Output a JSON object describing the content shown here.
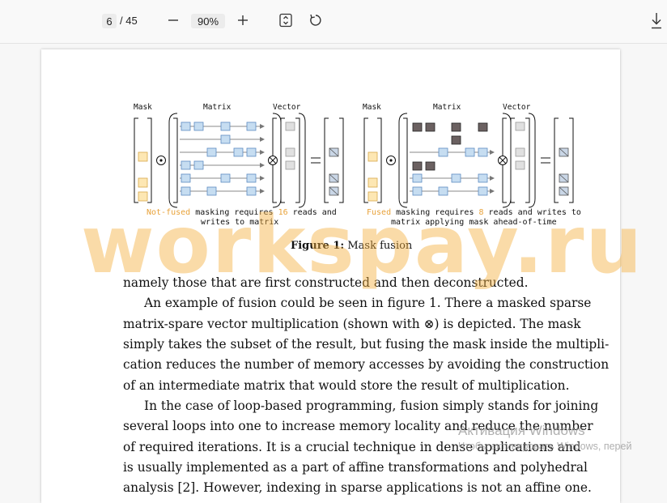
{
  "toolbar": {
    "page_current": "6",
    "page_total": "/ 45",
    "zoom_out": "−",
    "zoom_level": "90%",
    "zoom_in": "+"
  },
  "figure": {
    "left": {
      "mask_label": "Mask",
      "matrix_label": "Matrix",
      "vector_label": "Vector",
      "caption_line1_highlight": "Not-fused",
      "caption_line1_a": " masking requires ",
      "caption_line1_number": "16",
      "caption_line1_b": " reads and",
      "caption_line2": "writes to matrix"
    },
    "right": {
      "mask_label": "Mask",
      "matrix_label": "Matrix",
      "vector_label": "Vector",
      "caption_line1_highlight": "Fused",
      "caption_line1_a": " masking requires ",
      "caption_line1_number": "8",
      "caption_line1_b": " reads and writes to",
      "caption_line2": "matrix applying mask ahead-of-time"
    },
    "caption_label": "Figure 1:",
    "caption_text": "Mask fusion"
  },
  "body_text": {
    "lines": [
      "namely those that are first constructed and then deconstructed.",
      "An example of fusion could be seen in figure 1. There a masked sparse",
      "matrix-spare vector multiplication (shown with ⊗) is depicted.  The mask",
      "simply takes the subset of the result, but fusing the mask inside the multipli-",
      "cation reduces the number of memory accesses by avoiding the construction",
      "of an intermediate matrix that would store the result of multiplication.",
      "In the case of loop-based programming, fusion simply stands for joining",
      "several loops into one to increase memory locality and reduce the number",
      "of required iterations.  It is a crucial technique in dense applications and",
      "is usually implemented as a part of affine transformations and polyhedral",
      "analysis [2]. However, indexing in sparse applications is not an affine one."
    ]
  },
  "watermark": "workspay.ru",
  "activation": {
    "title": "Активация Windows",
    "subtitle": "Чтобы активировать Windows, перей"
  },
  "colors": {
    "mask_fill": "#fde7b3",
    "mask_stroke": "#d8a94a",
    "matrix_fill": "#c6ddf1",
    "matrix_stroke": "#5d8cc1",
    "dark_cell": "#6b6161",
    "vector_fill": "#e0e0e0",
    "result_fill": "#c9d6e6",
    "accent_orange": "#e8a23a",
    "watermark_color": "#f4b03e"
  }
}
